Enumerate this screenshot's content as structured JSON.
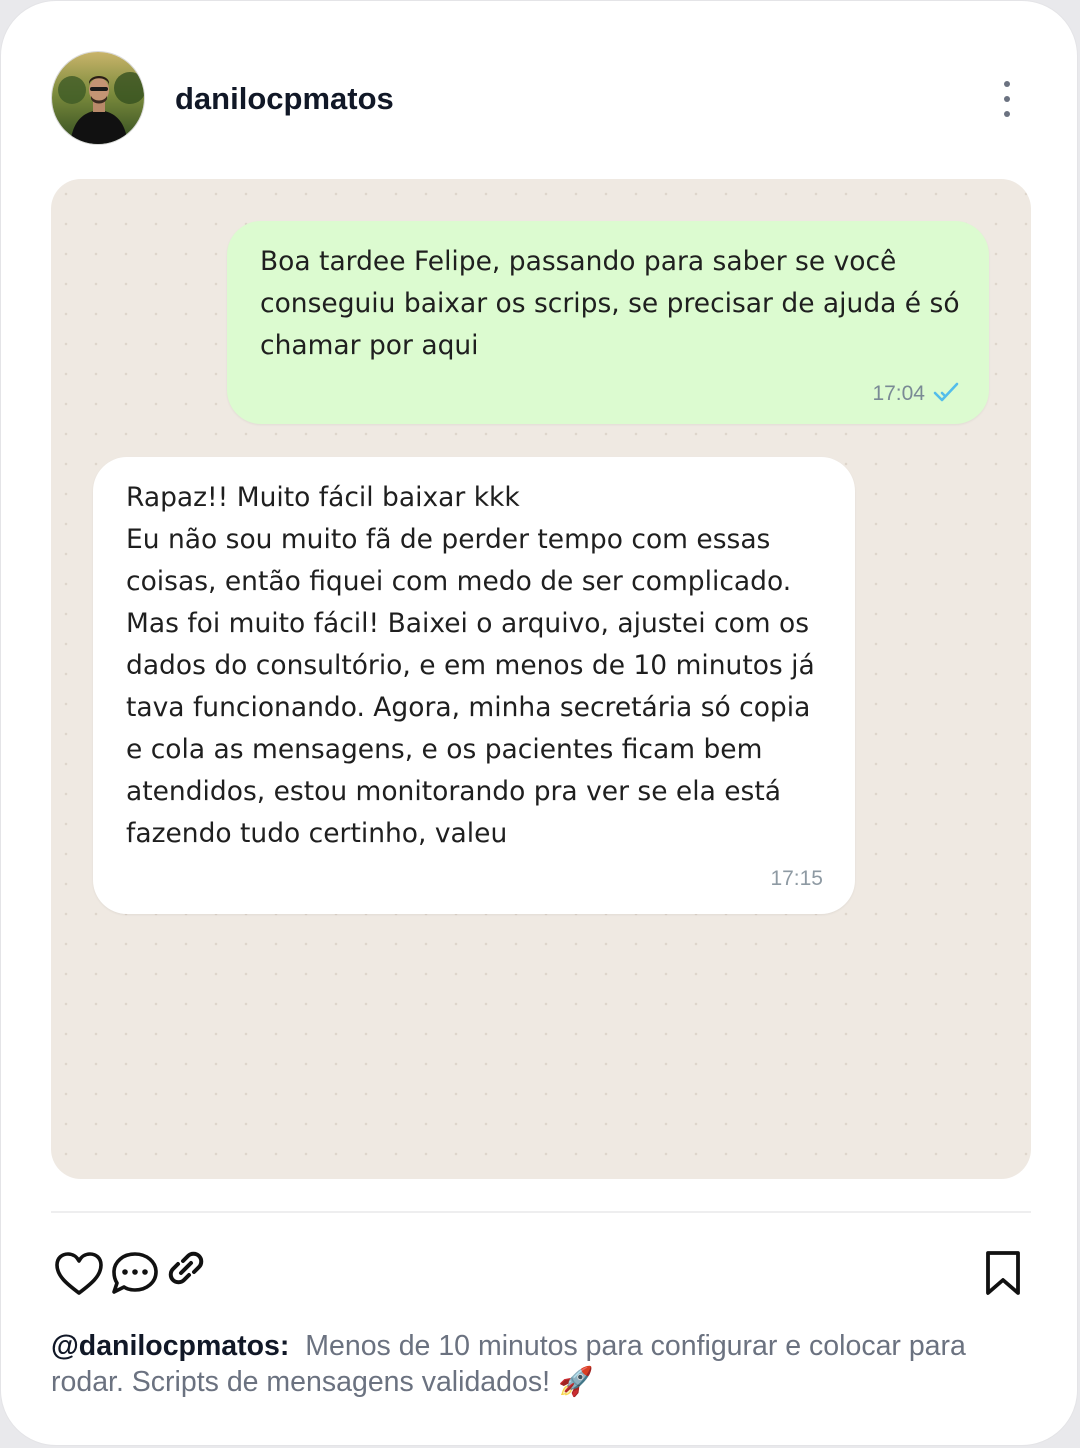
{
  "post": {
    "username": "danilocpmatos",
    "menu_icon": "more-vertical-icon"
  },
  "chat": {
    "outgoing": {
      "text": "Boa tardee Felipe, passando para saber se você\nconseguiu baixar os scrips, se precisar de ajuda é só\nchamar por aqui",
      "time": "17:04",
      "status_icon": "read-check-icon"
    },
    "incoming": {
      "text": "Rapaz!! Muito fácil baixar kkk\nEu não sou muito fã de perder tempo com essas\ncoisas, então fiquei com medo de ser complicado.\nMas foi muito fácil! Baixei o arquivo, ajustei com os\ndados do consultório, e em menos de 10 minutos já\ntava funcionando. Agora, minha secretária só copia\ne cola as mensagens, e os pacientes ficam bem\natendidos, estou monitorando pra ver se ela está\nfazendo tudo certinho, valeu",
      "time": "17:15"
    }
  },
  "actions": {
    "like_icon": "heart-icon",
    "comment_icon": "comment-icon",
    "share_icon": "link-icon",
    "save_icon": "bookmark-icon"
  },
  "caption": {
    "user": "@danilocpmatos:",
    "text": "Menos de 10 minutos para configurar e colocar para rodar. Scripts de mensagens validados! 🚀"
  },
  "colors": {
    "outgoing_bubble": "#dcfbd0",
    "incoming_bubble": "#ffffff",
    "chat_background": "#efe9e2",
    "read_check": "#53bdeb"
  }
}
